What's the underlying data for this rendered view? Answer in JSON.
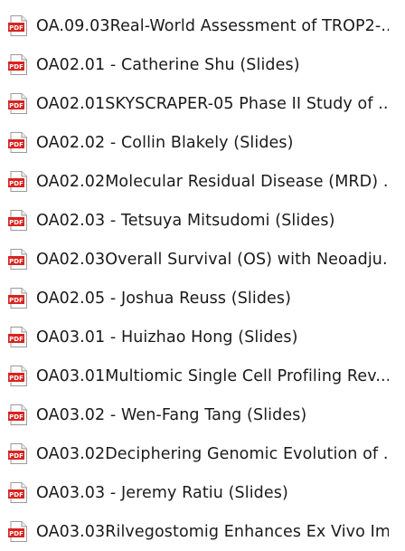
{
  "files": [
    {
      "name": "OA.09.03Real-World Assessment of TROP2-...",
      "icon": "pdf-file-icon"
    },
    {
      "name": "OA02.01 - Catherine Shu (Slides)",
      "icon": "pdf-file-icon"
    },
    {
      "name": "OA02.01SKYSCRAPER-05 Phase II Study of ...",
      "icon": "pdf-file-icon"
    },
    {
      "name": "OA02.02 - Collin Blakely (Slides)",
      "icon": "pdf-file-icon"
    },
    {
      "name": "OA02.02Molecular Residual Disease (MRD) ...",
      "icon": "pdf-file-icon"
    },
    {
      "name": "OA02.03 - Tetsuya Mitsudomi (Slides)",
      "icon": "pdf-file-icon"
    },
    {
      "name": "OA02.03Overall Survival (OS) with Neoadju...",
      "icon": "pdf-file-icon"
    },
    {
      "name": "OA02.05 - Joshua Reuss (Slides)",
      "icon": "pdf-file-icon"
    },
    {
      "name": "OA03.01 - Huizhao Hong (Slides)",
      "icon": "pdf-file-icon"
    },
    {
      "name": "OA03.01Multiomic Single Cell Profiling Rev...",
      "icon": "pdf-file-icon"
    },
    {
      "name": "OA03.02 - Wen-Fang Tang (Slides)",
      "icon": "pdf-file-icon"
    },
    {
      "name": "OA03.02Deciphering Genomic Evolution of ...",
      "icon": "pdf-file-icon"
    },
    {
      "name": "OA03.03 - Jeremy Ratiu (Slides)",
      "icon": "pdf-file-icon"
    },
    {
      "name": "OA03.03Rilvegostomig Enhances Ex Vivo Im...",
      "icon": "pdf-file-icon"
    }
  ],
  "colors": {
    "pdf_red": "#d9241f",
    "text": "#1a1a1a"
  }
}
